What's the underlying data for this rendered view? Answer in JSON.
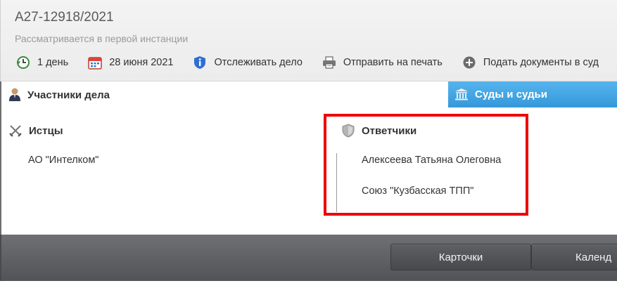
{
  "case": {
    "number": "А27-12918/2021",
    "status": "Рассматривается в первой инстанции"
  },
  "toolbar": {
    "items": [
      {
        "label": "1 день",
        "icon": "clock-history-icon"
      },
      {
        "label": "28 июня 2021",
        "icon": "calendar-icon"
      },
      {
        "label": "Отслеживать дело",
        "icon": "info-shield-icon"
      },
      {
        "label": "Отправить на печать",
        "icon": "printer-icon"
      },
      {
        "label": "Подать документы в суд",
        "icon": "plus-circle-icon"
      }
    ]
  },
  "participants": {
    "title": "Участники дела",
    "plaintiffs": {
      "title": "Истцы",
      "items": [
        "АО \"Интелком\""
      ]
    },
    "defendants": {
      "title": "Ответчики",
      "items": [
        "Алексеева Татьяна Олеговна",
        "Союз \"Кузбасская ТПП\""
      ]
    }
  },
  "courts_tab": {
    "label": "Суды и судьи"
  },
  "bottom_bar": {
    "buttons": [
      "Карточки",
      "Календ"
    ]
  },
  "colors": {
    "accent_tab": "#3698d9",
    "highlight": "#ee0000",
    "bottom_bar": "#5a5c60"
  }
}
